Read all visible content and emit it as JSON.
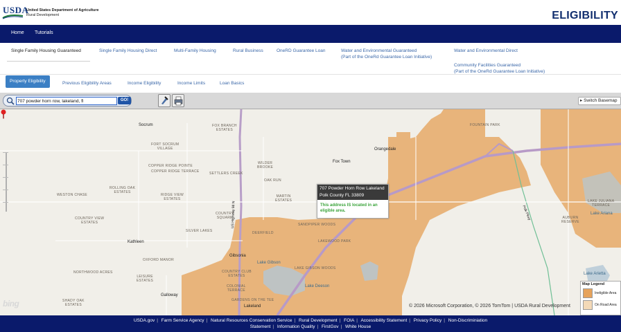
{
  "header": {
    "logo": "USDA",
    "agency_line1": "United States Department of Agriculture",
    "agency_line2": "Rural Development",
    "page_title": "ELIGIBILITY",
    "brand_color": "#112e6e"
  },
  "topnav": {
    "items": [
      "Home",
      "Tutorials"
    ]
  },
  "program_tabs": {
    "single_family_guaranteed": "Single Family Housing Guaranteed",
    "single_family_direct": "Single Family Housing Direct",
    "multi_family": "Multi-Family Housing",
    "rural_business": "Rural Business",
    "onerd": "OneRD Guarantee Loan",
    "water_guaranteed_l1": "Water and Environmental Guaranteed",
    "water_guaranteed_l2": "(Part of the OneRd Guarantee Loan Initiative)",
    "water_direct": "Water and Environmental Direct",
    "community_l1": "Community Facilities Guaranteed",
    "community_l2": "(Part of the OneRd Guarantee Loan Initiative)"
  },
  "sub_tabs": {
    "property_eligibility": "Property Eligibility",
    "previous_areas": "Previous Eligibility Areas",
    "income_eligibility": "Income Eligibility",
    "income_limits": "Income Limits",
    "loan_basics": "Loan Basics"
  },
  "toolbar": {
    "search_value": "707 powder horn row, lakeland, fl",
    "go_label": "GO!",
    "switch_basemap": "▸ Switch Basemap"
  },
  "map": {
    "popup_address": "707 Powder Horn Row Lakeland",
    "popup_city": "Polk County FL 33809",
    "popup_message": "This address IS located in an eligible area.",
    "legend_title": "Map Legend",
    "legend_ineligible": "Ineligible Area",
    "legend_on_road": "On Road Area",
    "bing": "bing",
    "copyright": "© 2026 Microsoft Corporation, © 2026 TomTom | USDA Rural Development",
    "ineligible_color": "#e6a35c",
    "road_color": "#f3d9b7",
    "labels": {
      "socrum": "Socrum",
      "fox_branch": "FOX BRANCH\nESTATES",
      "fort_socrum": "FORT SOCRUM\nVILLAGE",
      "copper_ridge_pointe": "COPPER RIDGE POINTE",
      "copper_ridge_terrace": "COPPER RIDGE TERRACE",
      "settlers_creek": "SETTLERS CREEK",
      "wilder_brooke": "WILDER\nBROOKE",
      "fox_town": "Fox Town",
      "orangedale": "Orangedale",
      "rolling_oak": "ROLLING OAK\nESTATES",
      "weston_chase": "WESTON CHASE",
      "ridge_view": "RIDGE VIEW\nESTATES",
      "oak_run": "OAK RUN",
      "martin_estates": "MARTIN\nESTATES",
      "country_square": "COUNTRY\nSQUARE",
      "country_view": "COUNTRY VIEW\nESTATES",
      "silver_lakes": "SILVER LAKES",
      "sandpiper": "SANDPIPER WOODS",
      "deerfield": "DEERFIELD",
      "lakewood_park": "LAKEWOOD PARK",
      "kathleen": "Kathleen",
      "gibsonia": "Gibsonia",
      "oxford_manor": "OXFORD MANOR",
      "northwood": "NORTHWOOD ACRES",
      "leisure": "LEISURE\nESTATES",
      "galloway": "Galloway",
      "shady_oak": "SHADY OAK\nESTATES",
      "lake_gibson": "Lake Gibson",
      "lake_gibson_woods": "LAKE GIBSON WOODS",
      "fountain_park": "FOUNTAIN PARK",
      "lakeland": "Lakeland",
      "auburn": "AUBURN\nRESERVE",
      "lake_juliana": "LAKE JULIANA\nTERRACE",
      "lake_ariana": "Lake Ariana",
      "lake_arietta": "Lake Arietta",
      "country_club": "COUNTRY CLUB\nESTATES",
      "colonial": "COLONIAL\nTERRACE",
      "gardens": "GARDENS ON THE TEE",
      "lake_deeson": "Lake Deeson",
      "us_highway_98": "US Highway 98 N",
      "polk_pkwy": "Polk Pkwy"
    }
  },
  "footer": {
    "row1": [
      "USDA.gov",
      "Farm Service Agency",
      "Natural Resources Conservation Service",
      "Rural Development",
      "FOIA",
      "Accessibility Statement",
      "Privacy Policy",
      "Non-Discriminiation"
    ],
    "row2": [
      "Statement",
      "Information Quality",
      "FirstGov",
      "White House"
    ]
  }
}
